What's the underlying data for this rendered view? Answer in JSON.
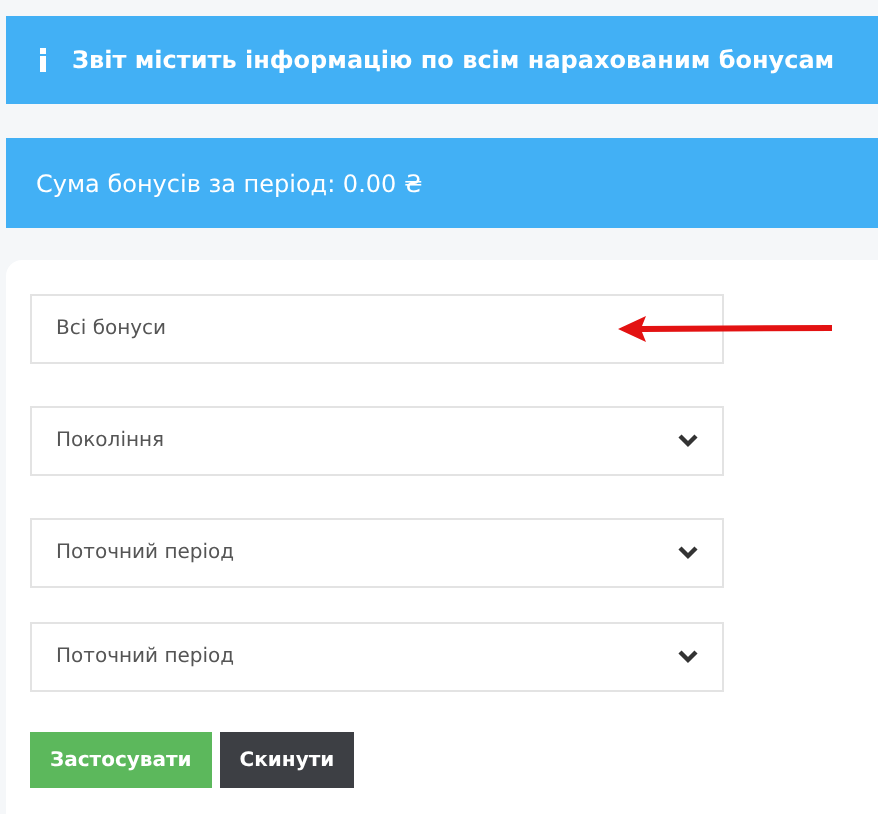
{
  "info_banner": {
    "text": "Звіт містить інформацію по всім нарахованим бонусам"
  },
  "total_banner": {
    "text": "Сума бонусів за період: 0.00 ₴"
  },
  "filters": [
    {
      "value": "Всі бонуси"
    },
    {
      "value": "Покоління"
    },
    {
      "value": "Поточний період"
    },
    {
      "value": "Поточний період"
    }
  ],
  "buttons": [
    {
      "label": "Застосувати",
      "kind": "primary"
    },
    {
      "label": "Скинути",
      "kind": "secondary"
    }
  ]
}
